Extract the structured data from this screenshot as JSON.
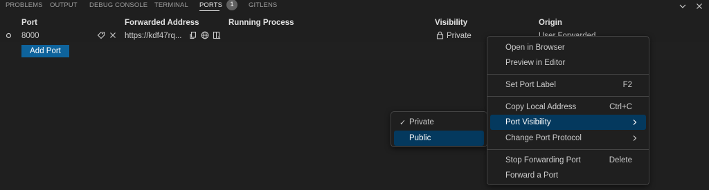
{
  "tabs": [
    {
      "label": "PROBLEMS"
    },
    {
      "label": "OUTPUT"
    },
    {
      "label": "DEBUG CONSOLE"
    },
    {
      "label": "TERMINAL"
    },
    {
      "label": "PORTS",
      "badge": "1"
    },
    {
      "label": "GITLENS"
    }
  ],
  "columns": {
    "port": "Port",
    "forwarded": "Forwarded Address",
    "process": "Running Process",
    "visibility": "Visibility",
    "origin": "Origin"
  },
  "row": {
    "port": "8000",
    "address": "https://kdf47rq...",
    "process": "",
    "visibility": "Private",
    "origin": "User Forwarded"
  },
  "add_port_label": "Add Port",
  "context_menu": {
    "open_browser": "Open in Browser",
    "preview_editor": "Preview in Editor",
    "set_label": "Set Port Label",
    "set_label_key": "F2",
    "copy_address": "Copy Local Address",
    "copy_address_key": "Ctrl+C",
    "port_visibility": "Port Visibility",
    "change_protocol": "Change Port Protocol",
    "stop_forwarding": "Stop Forwarding Port",
    "stop_forwarding_key": "Delete",
    "forward_port": "Forward a Port"
  },
  "visibility_menu": {
    "private": "Private",
    "public": "Public",
    "checked": "Private"
  },
  "colors": {
    "background": "#1f1f1f",
    "highlight": "#04395e",
    "button": "#0e639c",
    "border": "#454545"
  }
}
